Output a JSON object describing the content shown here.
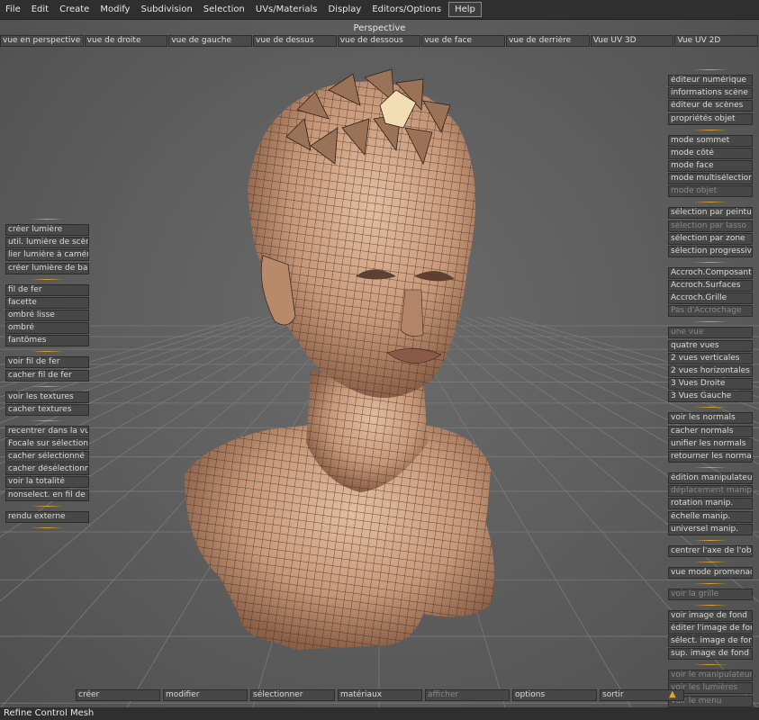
{
  "menubar": {
    "items": [
      "File",
      "Edit",
      "Create",
      "Modify",
      "Subdivision",
      "Selection",
      "UVs/Materials",
      "Display",
      "Editors/Options",
      "Help"
    ]
  },
  "viewport": {
    "title": "Perspective",
    "views": [
      "vue en perspective",
      "vue de droite",
      "vue de gauche",
      "vue de dessus",
      "vue de dessous",
      "vue de face",
      "vue de derrière",
      "Vue UV 3D",
      "Vue UV 2D"
    ]
  },
  "left_panel": {
    "groups": [
      [
        {
          "label": "créer lumière"
        },
        {
          "label": "util. lumière de scène"
        },
        {
          "label": "lier lumière à caméra"
        },
        {
          "label": "créer lumière de base"
        }
      ],
      [
        {
          "label": "fil de fer"
        },
        {
          "label": "facette"
        },
        {
          "label": "ombré lisse"
        },
        {
          "label": "ombré"
        },
        {
          "label": "fantômes"
        }
      ],
      [
        {
          "label": "voir fil de fer"
        },
        {
          "label": "cacher fil de fer"
        }
      ],
      [
        {
          "label": "voir les textures"
        },
        {
          "label": "cacher textures"
        }
      ],
      [
        {
          "label": "recentrer dans la vue"
        },
        {
          "label": "Focale sur sélection"
        },
        {
          "label": "cacher sélectionné"
        },
        {
          "label": "cacher désélectionné"
        },
        {
          "label": "voir la totalité"
        },
        {
          "label": "nonselect. en fil de fer"
        }
      ],
      [
        {
          "label": "rendu externe"
        }
      ]
    ]
  },
  "right_panel": {
    "groups": [
      [
        {
          "label": "éditeur numérique"
        },
        {
          "label": "informations scène"
        },
        {
          "label": "éditeur de scènes"
        },
        {
          "label": "propriétés objet"
        }
      ],
      [
        {
          "label": "mode sommet"
        },
        {
          "label": "mode côté"
        },
        {
          "label": "mode face"
        },
        {
          "label": "mode multisélection"
        },
        {
          "label": "mode objet",
          "disabled": true
        }
      ],
      [
        {
          "label": "sélection par peinture"
        },
        {
          "label": "sélection par lasso",
          "disabled": true
        },
        {
          "label": "sélection par zone"
        },
        {
          "label": "sélection progressive"
        }
      ],
      [
        {
          "label": "Accroch.Composants"
        },
        {
          "label": "Accroch.Surfaces"
        },
        {
          "label": "Accroch.Grille"
        },
        {
          "label": "Pas d'Accrochage",
          "disabled": true
        }
      ],
      [
        {
          "label": "une vue",
          "disabled": true
        },
        {
          "label": "quatre vues"
        },
        {
          "label": "2 vues verticales"
        },
        {
          "label": "2 vues horizontales"
        },
        {
          "label": "3 Vues Droite"
        },
        {
          "label": "3 Vues Gauche"
        }
      ],
      [
        {
          "label": "voir les normals"
        },
        {
          "label": "cacher normals"
        },
        {
          "label": "unifier les normals"
        },
        {
          "label": "retourner les normals"
        }
      ],
      [
        {
          "label": "édition manipulateur"
        },
        {
          "label": "déplacement manip.",
          "disabled": true
        },
        {
          "label": "rotation manip."
        },
        {
          "label": "échelle manip."
        },
        {
          "label": "universel manip."
        }
      ],
      [
        {
          "label": "centrer l'axe de l'objet"
        }
      ],
      [
        {
          "label": "vue mode promenade"
        }
      ],
      [
        {
          "label": "voir la grille",
          "disabled": true
        }
      ],
      [
        {
          "label": "voir image de fond"
        },
        {
          "label": "éditer l'image de fond"
        },
        {
          "label": "sélect. image de fond"
        },
        {
          "label": "sup. image de fond"
        }
      ],
      [
        {
          "label": "voir le manipulateur",
          "disabled": true
        },
        {
          "label": "voir les lumières",
          "disabled": true
        },
        {
          "label": "voir le menu",
          "disabled": true
        }
      ]
    ]
  },
  "bottom_bar": {
    "items": [
      {
        "label": "créer"
      },
      {
        "label": "modifier"
      },
      {
        "label": "sélectionner"
      },
      {
        "label": "matériaux"
      },
      {
        "label": "afficher",
        "disabled": true
      },
      {
        "label": "options"
      },
      {
        "label": "sortir"
      }
    ]
  },
  "status": {
    "text": "Refine Control Mesh"
  },
  "colors": {
    "accent": "#e0a42c",
    "mesh_skin": "#c99d80",
    "mesh_edge": "#3a2a22",
    "background": "#5a5a5a"
  }
}
